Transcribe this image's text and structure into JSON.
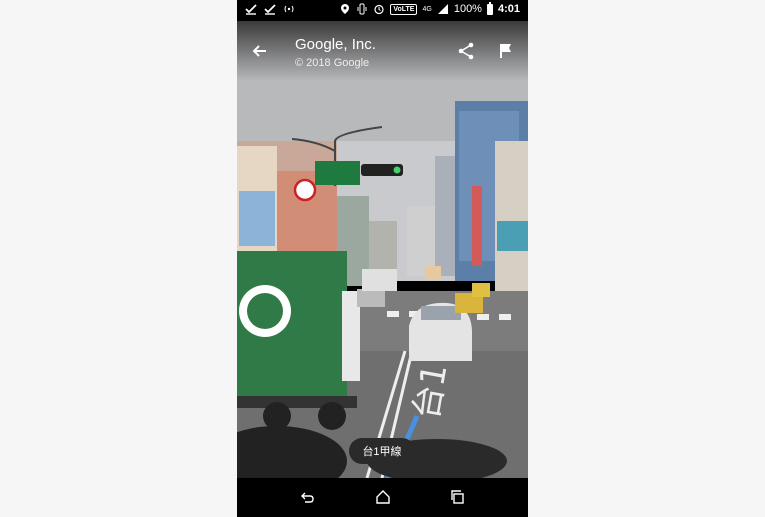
{
  "status_bar": {
    "battery_percent": "100%",
    "time": "4:01",
    "network_badge": "VoLTE",
    "network_type": "4G"
  },
  "header": {
    "title": "Google, Inc.",
    "subtitle": "© 2018 Google"
  },
  "road": {
    "label": "台1甲線"
  },
  "icons": {
    "back": "arrow-back-icon",
    "share": "share-icon",
    "report": "flag-icon",
    "nav_back": "nav-back-icon",
    "nav_home": "nav-home-icon",
    "nav_recents": "nav-recents-icon"
  }
}
